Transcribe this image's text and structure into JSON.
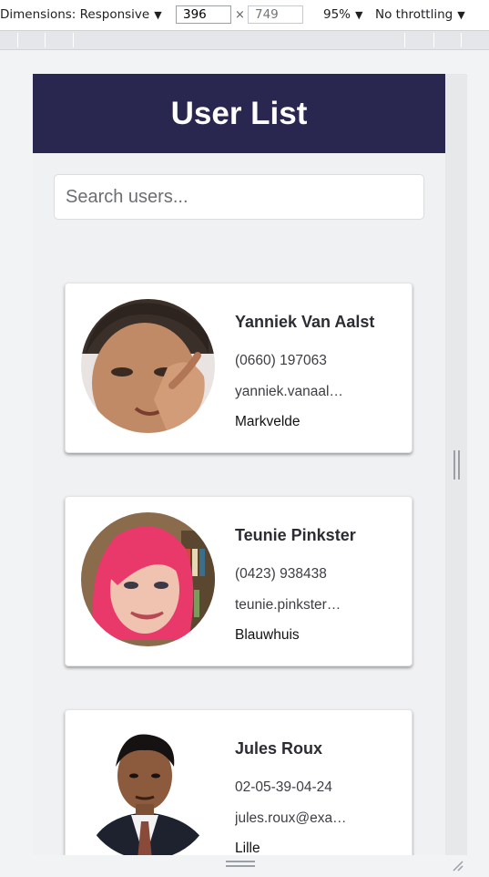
{
  "devtools": {
    "dimensions_label": "Dimensions: Responsive",
    "width_value": "396",
    "times_symbol": "×",
    "height_placeholder": "749",
    "zoom": "95%",
    "throttling": "No throttling",
    "dropdown_arrow": "▼"
  },
  "app": {
    "title": "User List",
    "search_placeholder": "Search users..."
  },
  "users": [
    {
      "name": "Yanniek Van Aalst",
      "phone": "(0660) 197063",
      "email": "yanniek.vanaal…",
      "city": "Markvelde"
    },
    {
      "name": "Teunie Pinkster",
      "phone": "(0423) 938438",
      "email": "teunie.pinkster…",
      "city": "Blauwhuis"
    },
    {
      "name": "Jules Roux",
      "phone": "02-05-39-04-24",
      "email": "jules.roux@exa…",
      "city": "Lille"
    }
  ]
}
